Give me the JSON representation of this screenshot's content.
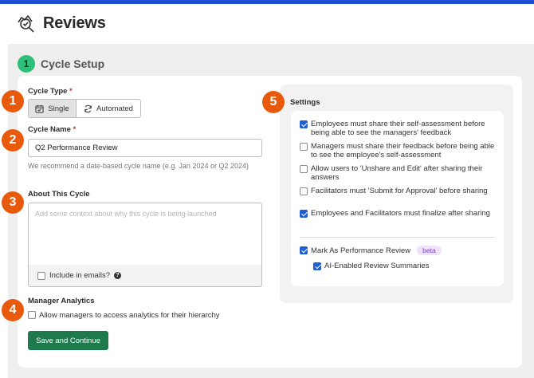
{
  "app": {
    "title": "Reviews"
  },
  "step": {
    "number": "1",
    "title": "Cycle Setup"
  },
  "badges": [
    "1",
    "2",
    "3",
    "4",
    "5"
  ],
  "cycle_type": {
    "label": "Cycle Type",
    "required_mark": "*",
    "options": [
      {
        "label": "Single",
        "icon": "calendar-icon",
        "selected": true
      },
      {
        "label": "Automated",
        "icon": "refresh-icon",
        "selected": false
      }
    ]
  },
  "cycle_name": {
    "label": "Cycle Name",
    "required_mark": "*",
    "value": "Q2 Performance Review",
    "help_text": "We recommend a date-based cycle name (e.g. Jan 2024 or Q2 2024)"
  },
  "about": {
    "label": "About This Cycle",
    "placeholder": "Add some context about why this cycle is being launched",
    "include_label": "Include in emails?",
    "include_checked": false
  },
  "manager_analytics": {
    "label": "Manager Analytics",
    "option_label": "Allow managers to access analytics for their hierarchy",
    "checked": false
  },
  "save_button": "Save and Continue",
  "settings": {
    "title": "Settings",
    "items": [
      {
        "label": "Employees must share their self-assessment before being able to see the managers' feedback",
        "checked": true
      },
      {
        "label": "Managers must share their feedback before being able to see the employee's self-assessment",
        "checked": false
      },
      {
        "label": "Allow users to 'Unshare and Edit' after sharing their answers",
        "checked": false
      },
      {
        "label": "Facilitators must 'Submit for Approval' before sharing",
        "checked": false
      },
      {
        "label": "Employees and Facilitators must finalize after sharing",
        "checked": true
      }
    ],
    "performance_review": {
      "label": "Mark As Performance Review",
      "badge": "beta",
      "checked": true
    },
    "ai_summaries": {
      "label": "AI-Enabled Review Summaries",
      "checked": true
    }
  },
  "colors": {
    "accent_blue": "#1f4fd1",
    "step_green": "#2ebf78",
    "badge_orange": "#e8590c",
    "button_green": "#1e7a4c",
    "checkbox_blue": "#1d5fd6"
  }
}
